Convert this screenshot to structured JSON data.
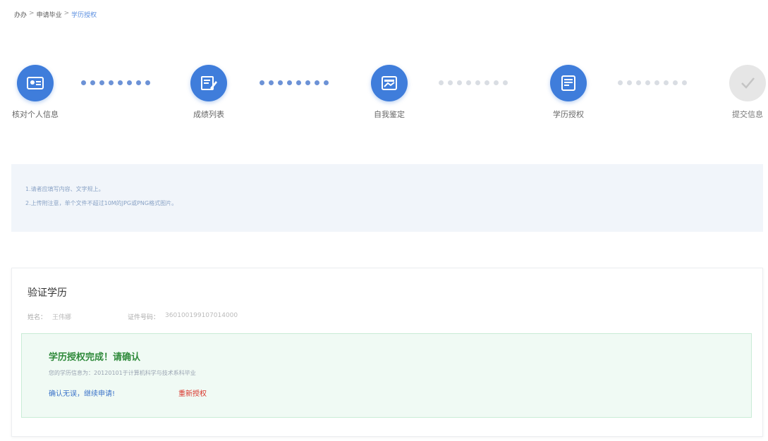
{
  "breadcrumb": {
    "items": [
      "办办",
      "申请毕业"
    ],
    "separator": ">",
    "current": "学历授权"
  },
  "steps": [
    {
      "label": "核对个人信息",
      "state": "done",
      "icon": "id-card-icon"
    },
    {
      "label": "成绩列表",
      "state": "done",
      "icon": "edit-list-icon"
    },
    {
      "label": "自我鉴定",
      "state": "done",
      "icon": "document-icon"
    },
    {
      "label": "学历授权",
      "state": "current",
      "icon": "form-icon"
    },
    {
      "label": "提交信息",
      "state": "pending",
      "icon": "check-icon"
    }
  ],
  "notice": {
    "line1": "1.请者应填写内容、文字规上。",
    "line2": "2.上传附注意，单个文件不超过10M的JPG或PNG格式图片。"
  },
  "verify_card": {
    "title": "验证学历",
    "name_label": "姓名：",
    "name_value": "王伟娜",
    "id_label": "证件号码：",
    "id_value": "360100199107014000",
    "success_title": "学历授权完成！请确认",
    "success_desc": "您的学历信息为：20120101于计算机科学与技术系科毕业",
    "confirm_link": "确认无误，继续申请!",
    "reauth_link": "重新授权"
  },
  "colors": {
    "accent": "#3f7ddb",
    "success_text": "#2f8a3b",
    "danger": "#d9352b",
    "notice_bg": "#f1f5fa"
  }
}
